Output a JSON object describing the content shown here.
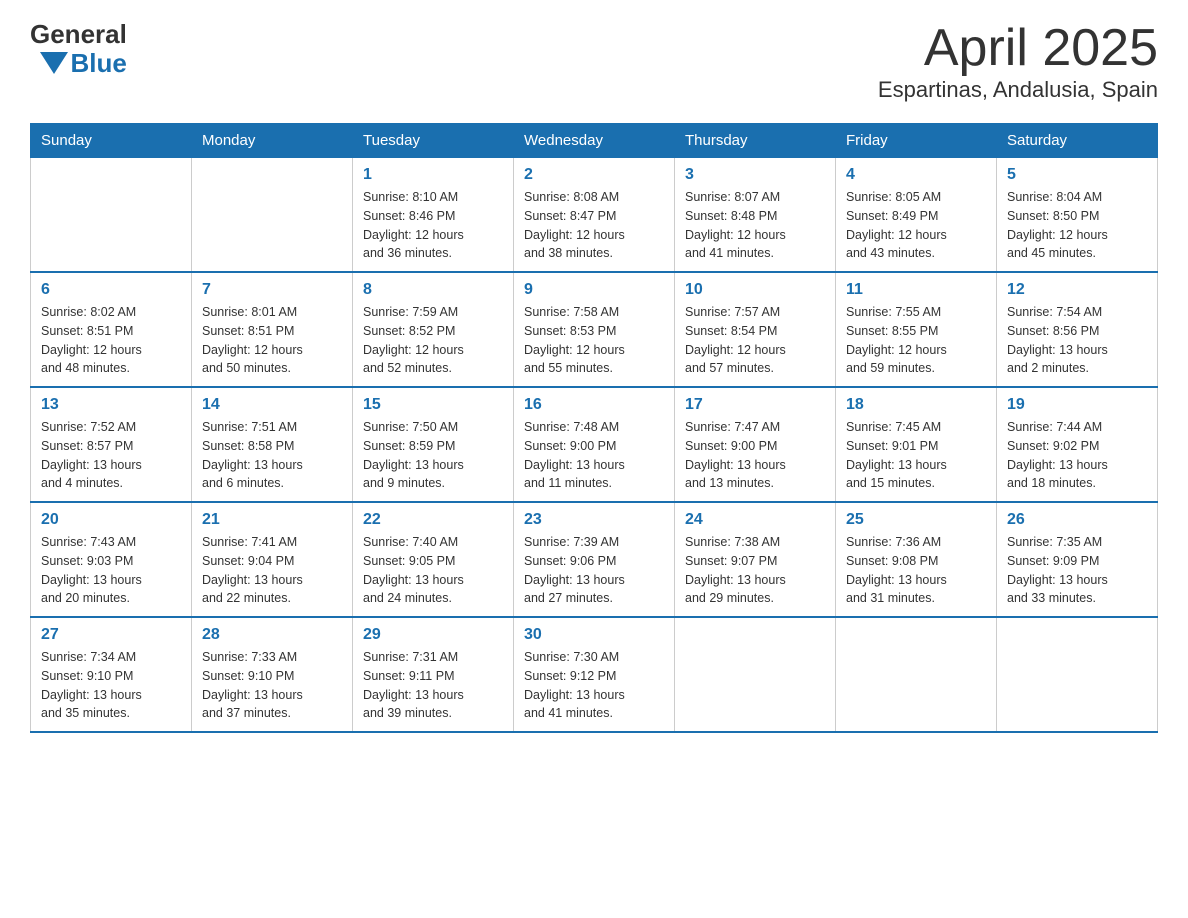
{
  "logo": {
    "text_general": "General",
    "text_blue": "Blue"
  },
  "title": "April 2025",
  "subtitle": "Espartinas, Andalusia, Spain",
  "days_of_week": [
    "Sunday",
    "Monday",
    "Tuesday",
    "Wednesday",
    "Thursday",
    "Friday",
    "Saturday"
  ],
  "weeks": [
    [
      {
        "day": "",
        "info": ""
      },
      {
        "day": "",
        "info": ""
      },
      {
        "day": "1",
        "info": "Sunrise: 8:10 AM\nSunset: 8:46 PM\nDaylight: 12 hours\nand 36 minutes."
      },
      {
        "day": "2",
        "info": "Sunrise: 8:08 AM\nSunset: 8:47 PM\nDaylight: 12 hours\nand 38 minutes."
      },
      {
        "day": "3",
        "info": "Sunrise: 8:07 AM\nSunset: 8:48 PM\nDaylight: 12 hours\nand 41 minutes."
      },
      {
        "day": "4",
        "info": "Sunrise: 8:05 AM\nSunset: 8:49 PM\nDaylight: 12 hours\nand 43 minutes."
      },
      {
        "day": "5",
        "info": "Sunrise: 8:04 AM\nSunset: 8:50 PM\nDaylight: 12 hours\nand 45 minutes."
      }
    ],
    [
      {
        "day": "6",
        "info": "Sunrise: 8:02 AM\nSunset: 8:51 PM\nDaylight: 12 hours\nand 48 minutes."
      },
      {
        "day": "7",
        "info": "Sunrise: 8:01 AM\nSunset: 8:51 PM\nDaylight: 12 hours\nand 50 minutes."
      },
      {
        "day": "8",
        "info": "Sunrise: 7:59 AM\nSunset: 8:52 PM\nDaylight: 12 hours\nand 52 minutes."
      },
      {
        "day": "9",
        "info": "Sunrise: 7:58 AM\nSunset: 8:53 PM\nDaylight: 12 hours\nand 55 minutes."
      },
      {
        "day": "10",
        "info": "Sunrise: 7:57 AM\nSunset: 8:54 PM\nDaylight: 12 hours\nand 57 minutes."
      },
      {
        "day": "11",
        "info": "Sunrise: 7:55 AM\nSunset: 8:55 PM\nDaylight: 12 hours\nand 59 minutes."
      },
      {
        "day": "12",
        "info": "Sunrise: 7:54 AM\nSunset: 8:56 PM\nDaylight: 13 hours\nand 2 minutes."
      }
    ],
    [
      {
        "day": "13",
        "info": "Sunrise: 7:52 AM\nSunset: 8:57 PM\nDaylight: 13 hours\nand 4 minutes."
      },
      {
        "day": "14",
        "info": "Sunrise: 7:51 AM\nSunset: 8:58 PM\nDaylight: 13 hours\nand 6 minutes."
      },
      {
        "day": "15",
        "info": "Sunrise: 7:50 AM\nSunset: 8:59 PM\nDaylight: 13 hours\nand 9 minutes."
      },
      {
        "day": "16",
        "info": "Sunrise: 7:48 AM\nSunset: 9:00 PM\nDaylight: 13 hours\nand 11 minutes."
      },
      {
        "day": "17",
        "info": "Sunrise: 7:47 AM\nSunset: 9:00 PM\nDaylight: 13 hours\nand 13 minutes."
      },
      {
        "day": "18",
        "info": "Sunrise: 7:45 AM\nSunset: 9:01 PM\nDaylight: 13 hours\nand 15 minutes."
      },
      {
        "day": "19",
        "info": "Sunrise: 7:44 AM\nSunset: 9:02 PM\nDaylight: 13 hours\nand 18 minutes."
      }
    ],
    [
      {
        "day": "20",
        "info": "Sunrise: 7:43 AM\nSunset: 9:03 PM\nDaylight: 13 hours\nand 20 minutes."
      },
      {
        "day": "21",
        "info": "Sunrise: 7:41 AM\nSunset: 9:04 PM\nDaylight: 13 hours\nand 22 minutes."
      },
      {
        "day": "22",
        "info": "Sunrise: 7:40 AM\nSunset: 9:05 PM\nDaylight: 13 hours\nand 24 minutes."
      },
      {
        "day": "23",
        "info": "Sunrise: 7:39 AM\nSunset: 9:06 PM\nDaylight: 13 hours\nand 27 minutes."
      },
      {
        "day": "24",
        "info": "Sunrise: 7:38 AM\nSunset: 9:07 PM\nDaylight: 13 hours\nand 29 minutes."
      },
      {
        "day": "25",
        "info": "Sunrise: 7:36 AM\nSunset: 9:08 PM\nDaylight: 13 hours\nand 31 minutes."
      },
      {
        "day": "26",
        "info": "Sunrise: 7:35 AM\nSunset: 9:09 PM\nDaylight: 13 hours\nand 33 minutes."
      }
    ],
    [
      {
        "day": "27",
        "info": "Sunrise: 7:34 AM\nSunset: 9:10 PM\nDaylight: 13 hours\nand 35 minutes."
      },
      {
        "day": "28",
        "info": "Sunrise: 7:33 AM\nSunset: 9:10 PM\nDaylight: 13 hours\nand 37 minutes."
      },
      {
        "day": "29",
        "info": "Sunrise: 7:31 AM\nSunset: 9:11 PM\nDaylight: 13 hours\nand 39 minutes."
      },
      {
        "day": "30",
        "info": "Sunrise: 7:30 AM\nSunset: 9:12 PM\nDaylight: 13 hours\nand 41 minutes."
      },
      {
        "day": "",
        "info": ""
      },
      {
        "day": "",
        "info": ""
      },
      {
        "day": "",
        "info": ""
      }
    ]
  ]
}
